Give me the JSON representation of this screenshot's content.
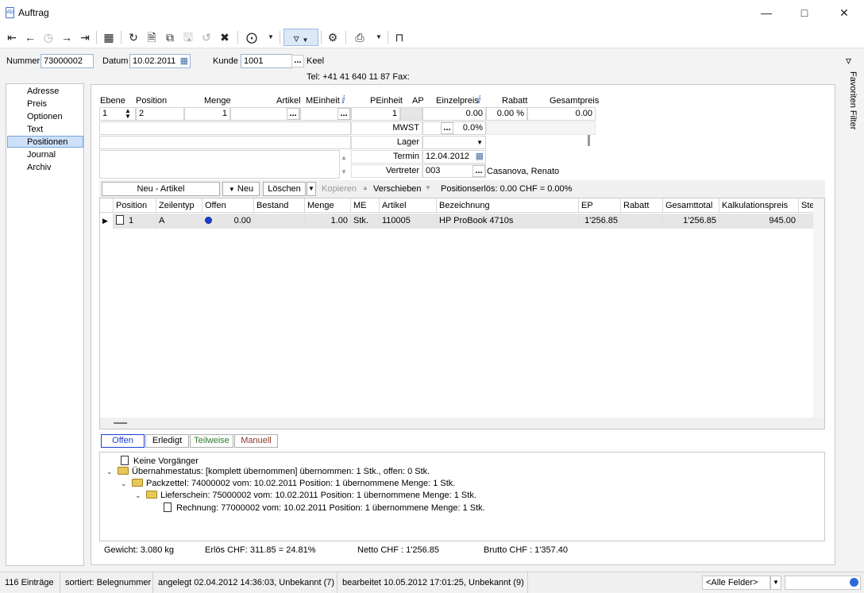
{
  "window": {
    "title": "Auftrag",
    "icon_text": "Ab"
  },
  "header": {
    "nummer_label": "Nummer",
    "nummer": "73000002",
    "datum_label": "Datum",
    "datum": "10.02.2011",
    "kunde_label": "Kunde",
    "kunde": "1001",
    "kunde_name": "Keel",
    "contact": "Tel: +41 41 640 11 87   Fax:"
  },
  "nav": {
    "items": [
      "Adresse",
      "Preis",
      "Optionen",
      "Text",
      "Positionen",
      "Journal",
      "Archiv"
    ],
    "selected": "Positionen"
  },
  "favorites_label": "Favoriten Filter",
  "editor": {
    "headers": {
      "ebene": "Ebene",
      "position": "Position",
      "menge": "Menge",
      "artikel": "Artikel",
      "meinheit": "MEinheit",
      "peinheit": "PEinheit",
      "ap": "AP",
      "einzelpreis": "Einzelpreis",
      "rabatt": "Rabatt",
      "gesamtpreis": "Gesamtpreis"
    },
    "values": {
      "ebene": "1",
      "position": "2",
      "menge": "1",
      "peinheit": "1",
      "einzelpreis": "0.00",
      "rabatt": "0.00 %",
      "gesamtpreis": "0.00"
    },
    "mwst_label": "MWST",
    "mwst": "0.0%",
    "lager_label": "Lager",
    "termin_label": "Termin",
    "termin": "12.04.2012",
    "vertreter_label": "Vertreter",
    "vertreter": "003",
    "vertreter_name": "Casanova, Renato"
  },
  "actions": {
    "neu_artikel": "Neu - Artikel",
    "neu": "Neu",
    "loeschen": "Löschen",
    "kopieren": "Kopieren",
    "verschieben": "Verschieben",
    "positionserloes": "Positionserlös:  0.00 CHF = 0.00%"
  },
  "grid": {
    "columns": [
      "Position",
      "Zeilentyp",
      "Offen",
      "Bestand",
      "Menge",
      "ME",
      "Artikel",
      "Bezeichnung",
      "EP",
      "Rabatt",
      "Gesamttotal",
      "Kalkulationspreis",
      "Ste"
    ],
    "rows": [
      {
        "position": "1",
        "zeilentyp": "A",
        "offen": "0.00",
        "bestand": "",
        "menge": "1.00",
        "me": "Stk.",
        "artikel": "110005",
        "bezeichnung": "HP ProBook 4710s",
        "ep": "1'256.85",
        "rabatt": "",
        "gesamttotal": "1'256.85",
        "kalkulationspreis": "945.00",
        "ste": ""
      }
    ]
  },
  "status_tabs": [
    "Offen",
    "Erledigt",
    "Teilweise",
    "Manuell"
  ],
  "tree": [
    "Keine Vorgänger",
    "Übernahmestatus: [komplett übernommen] übernommen: 1 Stk., offen: 0 Stk.",
    "Packzettel: 74000002 vom: 10.02.2011 Position: 1 übernommene Menge: 1 Stk.",
    "Lieferschein: 75000002 vom: 10.02.2011 Position: 1 übernommene Menge: 1 Stk.",
    "Rechnung: 77000002 vom: 10.02.2011 Position: 1 übernommene Menge: 1 Stk."
  ],
  "totals": {
    "gewicht": "Gewicht:  3.080 kg",
    "erloes": "Erlös CHF: 311.85 = 24.81%",
    "netto": "Netto CHF :  1'256.85",
    "brutto": "Brutto CHF :  1'357.40"
  },
  "statusbar": {
    "count": "116 Einträge",
    "sort": "sortiert: Belegnummer",
    "created": "angelegt 02.04.2012 14:36:03, Unbekannt (7)",
    "edited": "bearbeitet 10.05.2012 17:01:25, Unbekannt (9)",
    "filter": "<Alle Felder>"
  }
}
